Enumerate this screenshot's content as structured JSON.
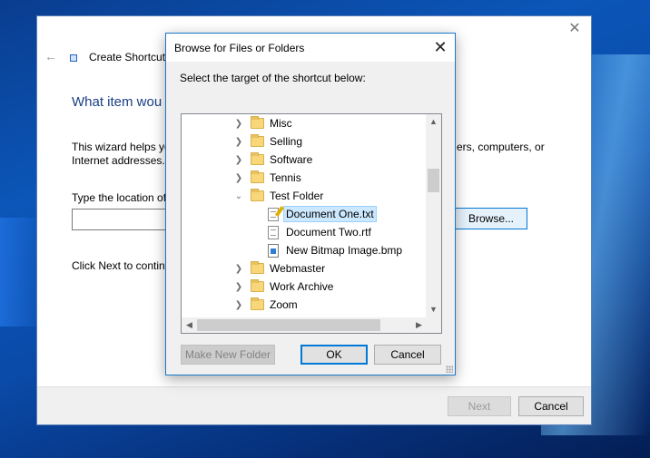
{
  "wizard": {
    "title": "Create Shortcut",
    "heading": "What item wou",
    "desc_line1": "This wizard helps yo",
    "desc_line2": "Internet addresses.",
    "desc_right": "ers, computers, or",
    "location_label": "Type the location of",
    "location_value": "",
    "browse_label": "Browse...",
    "next_hint": "Click Next to contin",
    "next_label": "Next",
    "cancel_label": "Cancel"
  },
  "dialog": {
    "title": "Browse for Files or Folders",
    "instruction": "Select the target of the shortcut below:",
    "tree": [
      {
        "label": "Misc",
        "type": "folder",
        "expanded": false
      },
      {
        "label": "Selling",
        "type": "folder",
        "expanded": false
      },
      {
        "label": "Software",
        "type": "folder",
        "expanded": false
      },
      {
        "label": "Tennis",
        "type": "folder",
        "expanded": false
      },
      {
        "label": "Test Folder",
        "type": "folder",
        "expanded": true
      },
      {
        "label": "Document One.txt",
        "type": "text-file",
        "selected": true
      },
      {
        "label": "Document Two.rtf",
        "type": "text-file"
      },
      {
        "label": "New Bitmap Image.bmp",
        "type": "image-file"
      },
      {
        "label": "Webmaster",
        "type": "folder",
        "expanded": false
      },
      {
        "label": "Work Archive",
        "type": "folder",
        "expanded": false
      },
      {
        "label": "Zoom",
        "type": "folder",
        "expanded": false
      }
    ],
    "make_folder_label": "Make New Folder",
    "ok_label": "OK",
    "cancel_label": "Cancel"
  },
  "colors": {
    "accent": "#0078d7",
    "selection": "#cce8ff",
    "heading": "#1a3f85"
  }
}
